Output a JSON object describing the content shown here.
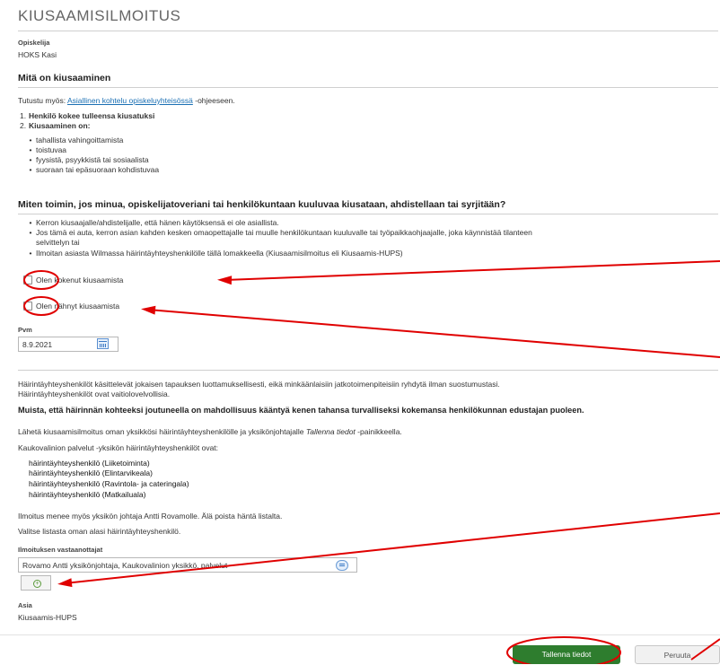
{
  "page": {
    "title": "KIUSAAMISILMOITUS"
  },
  "student": {
    "label": "Opiskelija",
    "value": "HOKS Kasi"
  },
  "section1": {
    "heading": "Mitä on kiusaaminen",
    "intro_prefix": "Tutustu myös:",
    "intro_link": "Asiallinen kohtelu opiskeluyhteisössä",
    "intro_suffix": "-ohjeeseen.",
    "numbered": [
      {
        "n": "1.",
        "text": "Henkilö kokee tulleensa kiusatuksi"
      },
      {
        "n": "2.",
        "text": "Kiusaaminen on:"
      }
    ],
    "bullets": [
      "tahallista vahingoittamista",
      "toistuvaa",
      "fyysistä, psyykkistä tai sosiaalista",
      "suoraan tai epäsuoraan kohdistuvaa"
    ]
  },
  "section2": {
    "heading": "Miten toimin, jos minua, opiskelijatoveriani tai henkilökuntaan kuuluvaa kiusataan, ahdistellaan tai syrjitään?",
    "bullets": [
      "Kerron kiusaajalle/ahdistelijalle, että hänen käytöksensä ei ole asiallista.",
      "Jos tämä ei auta, kerron asian kahden kesken omaopettajalle tai muulle henkilökuntaan kuuluvalle tai työpaikkaohjaajalle, joka käynnistää tilanteen",
      "Ilmoitan asiasta Wilmassa häirintäyhteyshenkilölle tällä lomakkeella (Kiusaamisilmoitus eli Kiusaamis-HUPS)"
    ],
    "bullet2_cont": "selvittelyn tai"
  },
  "checkboxes": {
    "experienced": "Olen kokenut kiusaamista",
    "witnessed": "Olen nähnyt kiusaamista"
  },
  "date": {
    "label": "Pvm",
    "value": "8.9.2021"
  },
  "info": {
    "p1_line1": "Häirintäyhteyshenkilöt käsittelevät jokaisen tapauksen luottamuksellisesti, eikä minkäänlaisiin jatkotoimenpiteisiin ryhdytä ilman suostumustasi.",
    "p1_line2": "Häirintäyhteyshenkilöt ovat vaitiolovelvollisia.",
    "bold": "Muista, että häirinnän kohteeksi joutuneella on mahdollisuus kääntyä kenen tahansa turvalliseksi kokemansa henkilökunnan edustajan puoleen.",
    "send_prefix": "Lähetä kiusaamisilmoitus oman yksikkösi häirintäyhteyshenkilölle ja yksikönjohtajalle",
    "send_italic": "Tallenna tiedot",
    "send_suffix": "-painikkeella.",
    "unit_intro": "Kaukovalinion palvelut -yksikön häirintäyhteyshenkilöt ovat:",
    "contacts": [
      "häirintäyhteyshenkilö (Liiketoiminta)",
      "häirintäyhteyshenkilö (Elintarvikeala)",
      "häirintäyhteyshenkilö (Ravintola- ja cateringala)",
      "häirintäyhteyshenkilö (Matkailuala)"
    ],
    "notice": "Ilmoitus menee myös yksikön johtaja Antti Rovamolle. Älä poista häntä listalta.",
    "choose": "Valitse listasta oman alasi häirintäyhteyshenkilö."
  },
  "recipients": {
    "label": "Ilmoituksen vastaanottajat",
    "value": "Rovamo Antti yksikönjohtaja, Kaukovalinion yksikkö, palvelut"
  },
  "subject": {
    "label": "Asia",
    "value": "Kiusaamis-HUPS"
  },
  "buttons": {
    "save": "Tallenna tiedot",
    "cancel": "Peruuta"
  },
  "colors": {
    "annotation": "#e00000",
    "save_bg": "#2e7d2e",
    "link": "#1a6fb3"
  }
}
